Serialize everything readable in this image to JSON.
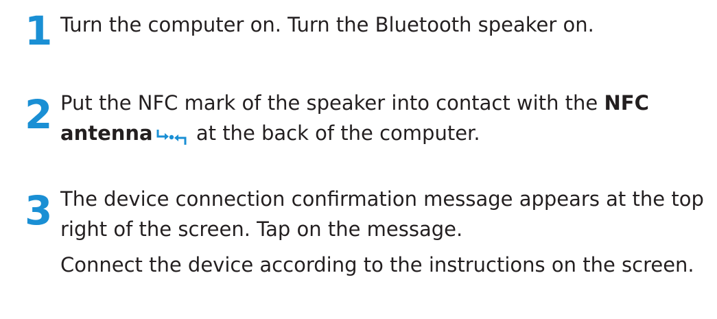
{
  "steps": [
    {
      "number": "1",
      "text": "Turn the computer on. Turn the Bluetooth speaker on."
    },
    {
      "number": "2",
      "text_before": "Put the NFC mark of the speaker into contact with the ",
      "bold_text": "NFC antenna",
      "text_after": " at the back of the computer.",
      "icon": "nfc-antenna-icon"
    },
    {
      "number": "3",
      "text": "The device connection confirmation message appears at the top right of the screen. Tap on the message.",
      "extra_text": "Connect the device according to the instructions on the screen."
    }
  ],
  "colors": {
    "step_number": "#1a8fd4",
    "text": "#231f20",
    "icon": "#1a8fd4"
  }
}
